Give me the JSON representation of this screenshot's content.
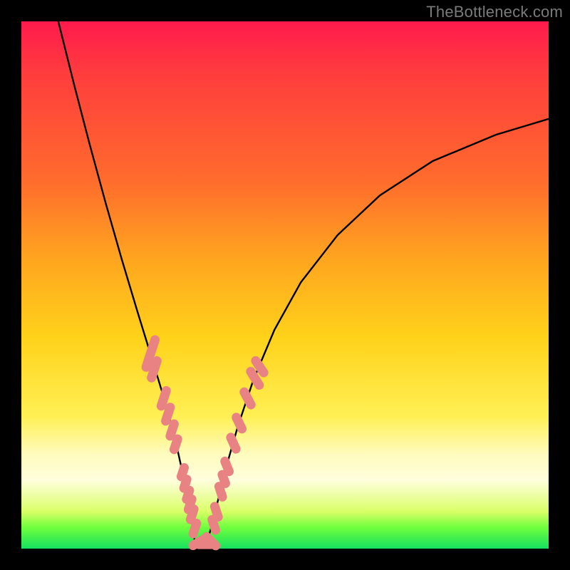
{
  "watermark": "TheBottleneck.com",
  "colors": {
    "frame": "#000000",
    "curve": "#000000",
    "marker_fill": "#e98383",
    "marker_stroke": "#c96a6a"
  },
  "chart_data": {
    "type": "line",
    "title": "",
    "xlabel": "",
    "ylabel": "",
    "xlim": [
      0,
      100
    ],
    "ylim": [
      0,
      100
    ],
    "series": [
      {
        "name": "left-curve",
        "x": [
          7,
          10,
          13,
          16,
          19,
          22,
          24,
          26,
          27.5,
          29,
          30,
          31,
          31.8,
          32.5,
          33
        ],
        "y": [
          100,
          88,
          76.5,
          65.5,
          55,
          45,
          38.5,
          32,
          27,
          21.5,
          17,
          12.5,
          8,
          4,
          0.5
        ]
      },
      {
        "name": "right-curve",
        "x": [
          35,
          36,
          37.5,
          39,
          41,
          44,
          48,
          53,
          60,
          68,
          78,
          90,
          100
        ],
        "y": [
          0.5,
          4,
          10,
          16,
          23,
          32,
          41.5,
          50.5,
          59.5,
          67,
          73.5,
          78.5,
          81.5
        ]
      }
    ],
    "markers": {
      "name": "highlighted-points",
      "shape": "capsule",
      "points": [
        {
          "x": 24.5,
          "y": 37,
          "len": 4.5,
          "angle": -72
        },
        {
          "x": 25.2,
          "y": 34,
          "len": 3.2,
          "angle": -72
        },
        {
          "x": 27.0,
          "y": 28.5,
          "len": 3.0,
          "angle": -72
        },
        {
          "x": 27.8,
          "y": 25.5,
          "len": 2.8,
          "angle": -72
        },
        {
          "x": 28.6,
          "y": 22.5,
          "len": 2.6,
          "angle": -72
        },
        {
          "x": 29.3,
          "y": 19.8,
          "len": 2.4,
          "angle": -72
        },
        {
          "x": 30.6,
          "y": 14.5,
          "len": 2.2,
          "angle": -72
        },
        {
          "x": 31.1,
          "y": 12.3,
          "len": 2.2,
          "angle": -72
        },
        {
          "x": 31.6,
          "y": 10.2,
          "len": 2.2,
          "angle": -72
        },
        {
          "x": 32.0,
          "y": 8.4,
          "len": 2.4,
          "angle": -72
        },
        {
          "x": 32.4,
          "y": 6.5,
          "len": 2.4,
          "angle": -72
        },
        {
          "x": 32.9,
          "y": 3.8,
          "len": 2.4,
          "angle": -72
        },
        {
          "x": 33.6,
          "y": 1.2,
          "len": 2.6,
          "angle": -30
        },
        {
          "x": 34.8,
          "y": 0.8,
          "len": 2.6,
          "angle": 0
        },
        {
          "x": 36.0,
          "y": 1.4,
          "len": 2.6,
          "angle": 45
        },
        {
          "x": 36.5,
          "y": 4.5,
          "len": 2.4,
          "angle": 72
        },
        {
          "x": 37.0,
          "y": 7.0,
          "len": 2.4,
          "angle": 72
        },
        {
          "x": 37.8,
          "y": 10.8,
          "len": 2.4,
          "angle": 72
        },
        {
          "x": 38.4,
          "y": 13.2,
          "len": 2.2,
          "angle": 70
        },
        {
          "x": 39.0,
          "y": 15.6,
          "len": 2.4,
          "angle": 68
        },
        {
          "x": 40.2,
          "y": 20.0,
          "len": 2.6,
          "angle": 66
        },
        {
          "x": 41.3,
          "y": 23.8,
          "len": 2.6,
          "angle": 64
        },
        {
          "x": 42.9,
          "y": 28.5,
          "len": 2.8,
          "angle": 62
        },
        {
          "x": 44.3,
          "y": 32.3,
          "len": 3.0,
          "angle": 58
        },
        {
          "x": 45.2,
          "y": 34.5,
          "len": 2.8,
          "angle": 56
        }
      ]
    }
  }
}
